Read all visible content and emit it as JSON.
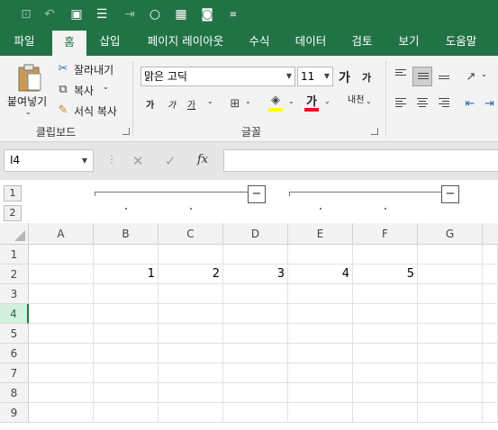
{
  "qat": {
    "icons": [
      "save-icon",
      "undo-icon",
      "redo-icon",
      "form-icon",
      "export-icon",
      "circle-icon",
      "grid-icon",
      "camera-icon",
      "customize-icon"
    ]
  },
  "tabs": [
    {
      "label": "파일"
    },
    {
      "label": "홈"
    },
    {
      "label": "삽입"
    },
    {
      "label": "페이지 레이아웃"
    },
    {
      "label": "수식"
    },
    {
      "label": "데이터"
    },
    {
      "label": "검토"
    },
    {
      "label": "보기"
    },
    {
      "label": "도움말"
    }
  ],
  "active_tab": "홈",
  "ribbon": {
    "clipboard": {
      "paste_label": "붙여넣기",
      "cut_label": "잘라내기",
      "copy_label": "복사",
      "format_painter_label": "서식 복사",
      "group_label": "클립보드"
    },
    "font": {
      "font_name": "맑은 고딕",
      "font_size": "11",
      "grow_label": "가",
      "shrink_label": "가",
      "bold_label": "가",
      "italic_label": "가",
      "underline_label": "가",
      "font_color_label": "가",
      "phonetic_label": "내천",
      "group_label": "글꼴"
    }
  },
  "formula_bar": {
    "name_box": "I4",
    "cancel_icon": "✕",
    "enter_icon": "✓",
    "fx_label": "fx",
    "formula": ""
  },
  "outline": {
    "levels": [
      "1",
      "2"
    ],
    "collapse_label": "−"
  },
  "sheet": {
    "columns": [
      "A",
      "B",
      "C",
      "D",
      "E",
      "F",
      "G"
    ],
    "rows": [
      "1",
      "2",
      "3",
      "4",
      "5",
      "6",
      "7",
      "8",
      "9"
    ],
    "selected_row": "4",
    "row2_values": [
      "",
      "1",
      "2",
      "3",
      "4",
      "5",
      ""
    ]
  },
  "colors": {
    "brand": "#217346",
    "ribbon_bg": "#f3f3f3",
    "font_color_bar": "#e81123",
    "highlight_bar": "#ffff00"
  }
}
